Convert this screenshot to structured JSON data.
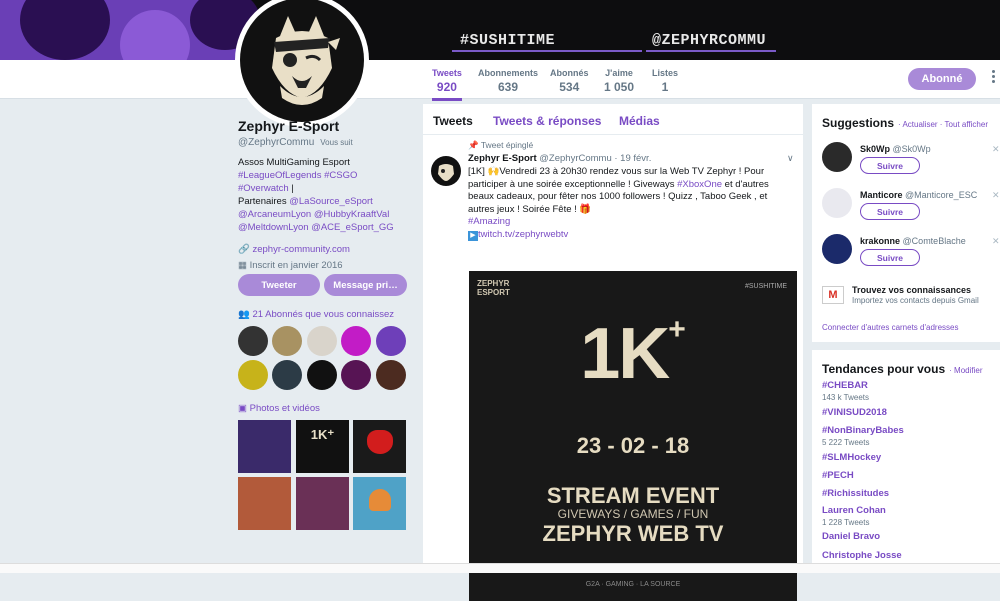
{
  "banner": {
    "hashtag": "#SUSHITIME",
    "handle": "@ZEPHYRCOMMU"
  },
  "nav": {
    "stats": [
      {
        "label": "Tweets",
        "value": "920"
      },
      {
        "label": "Abonnements",
        "value": "639"
      },
      {
        "label": "Abonnés",
        "value": "534"
      },
      {
        "label": "J'aime",
        "value": "1 050"
      },
      {
        "label": "Listes",
        "value": "1"
      }
    ],
    "follow_label": "Abonné"
  },
  "profile": {
    "name": "Zephyr E-Sport",
    "handle": "@ZephyrCommu",
    "follows_you": "Vous suit",
    "bio_line1": "Assos MultiGaming Esport",
    "bio_tags": "#LeagueOfLegends #CSGO #Overwatch",
    "bio_sep": " |",
    "bio_partners": "Partenaires ",
    "bio_p1": "@LaSource_eSport",
    "bio_p2": "@ArcaneumLyon @HubbyKraaftVal",
    "bio_p3": "@MeltdownLyon @ACE_eSport_GG",
    "website": "zephyr-community.com",
    "joined": "Inscrit en janvier 2016",
    "tweet_btn": "Tweeter",
    "message_btn": "Message pri…",
    "known_followers": "21 Abonnés que vous connaissez",
    "photos_label": "Photos et vidéos"
  },
  "timeline": {
    "tabs": [
      "Tweets",
      "Tweets & réponses",
      "Médias"
    ],
    "pinned_label": "Tweet épinglé",
    "author_name": "Zephyr E-Sport",
    "author_handle": "@ZephyrCommu",
    "date": "· 19 févr.",
    "text_1": "[1K] 🙌Vendredi 23 à 20h30 rendez vous sur la Web TV Zephyr ! Pour participer à une soirée exceptionnelle ! Giveways ",
    "text_tag1": "#XboxOne",
    "text_2": " et d'autres beaux cadeaux, pour fêter nos 1000 followers ! Quizz , Taboo Geek , et autres jeux ! Soirée Fête ! 🎁",
    "text_tag2": "#Amazing",
    "text_link": "twitch.tv/zephyrwebtv",
    "image": {
      "logo_line1": "ZEPHYR",
      "logo_line2": "ESPORT",
      "tag": "#SUSHITIME",
      "big": "1K",
      "plus": "+",
      "date": "23 - 02 - 18",
      "line1": "STREAM EVENT",
      "line2": "GIVEWAYS / GAMES / FUN",
      "line3": "ZEPHYR WEB TV",
      "sponsors": "G2A  ·  GAMING  ·  LA SOURCE"
    }
  },
  "suggestions": {
    "title": "Suggestions",
    "actions": "· Actualiser · Tout afficher",
    "follow_label": "Suivre",
    "items": [
      {
        "name": "Sk0Wp",
        "handle": "@Sk0Wp"
      },
      {
        "name": "Manticore",
        "handle": "@Manticore_ESC"
      },
      {
        "name": "krakonne",
        "handle": "@ComteBlache"
      }
    ],
    "contacts_title": "Trouvez vos connaissances",
    "contacts_sub": "Importez vos contacts depuis Gmail",
    "connect_link": "Connecter d'autres carnets d'adresses"
  },
  "trends": {
    "title": "Tendances pour vous",
    "modify": "· Modifier",
    "items": [
      {
        "tag": "#CHEBAR",
        "count": "143 k Tweets"
      },
      {
        "tag": "#VINISUD2018",
        "count": ""
      },
      {
        "tag": "#NonBinaryBabes",
        "count": "5 222 Tweets"
      },
      {
        "tag": "#SLMHockey",
        "count": ""
      },
      {
        "tag": "#PECH",
        "count": ""
      },
      {
        "tag": "#Richissitudes",
        "count": ""
      },
      {
        "tag": "Lauren Cohan",
        "count": "1 228 Tweets"
      },
      {
        "tag": "Daniel Bravo",
        "count": ""
      },
      {
        "tag": "Christophe Josse",
        "count": ""
      }
    ]
  },
  "colors": {
    "accent": "#794bc4",
    "button": "#a98ad8",
    "background": "#e6ecf0"
  }
}
